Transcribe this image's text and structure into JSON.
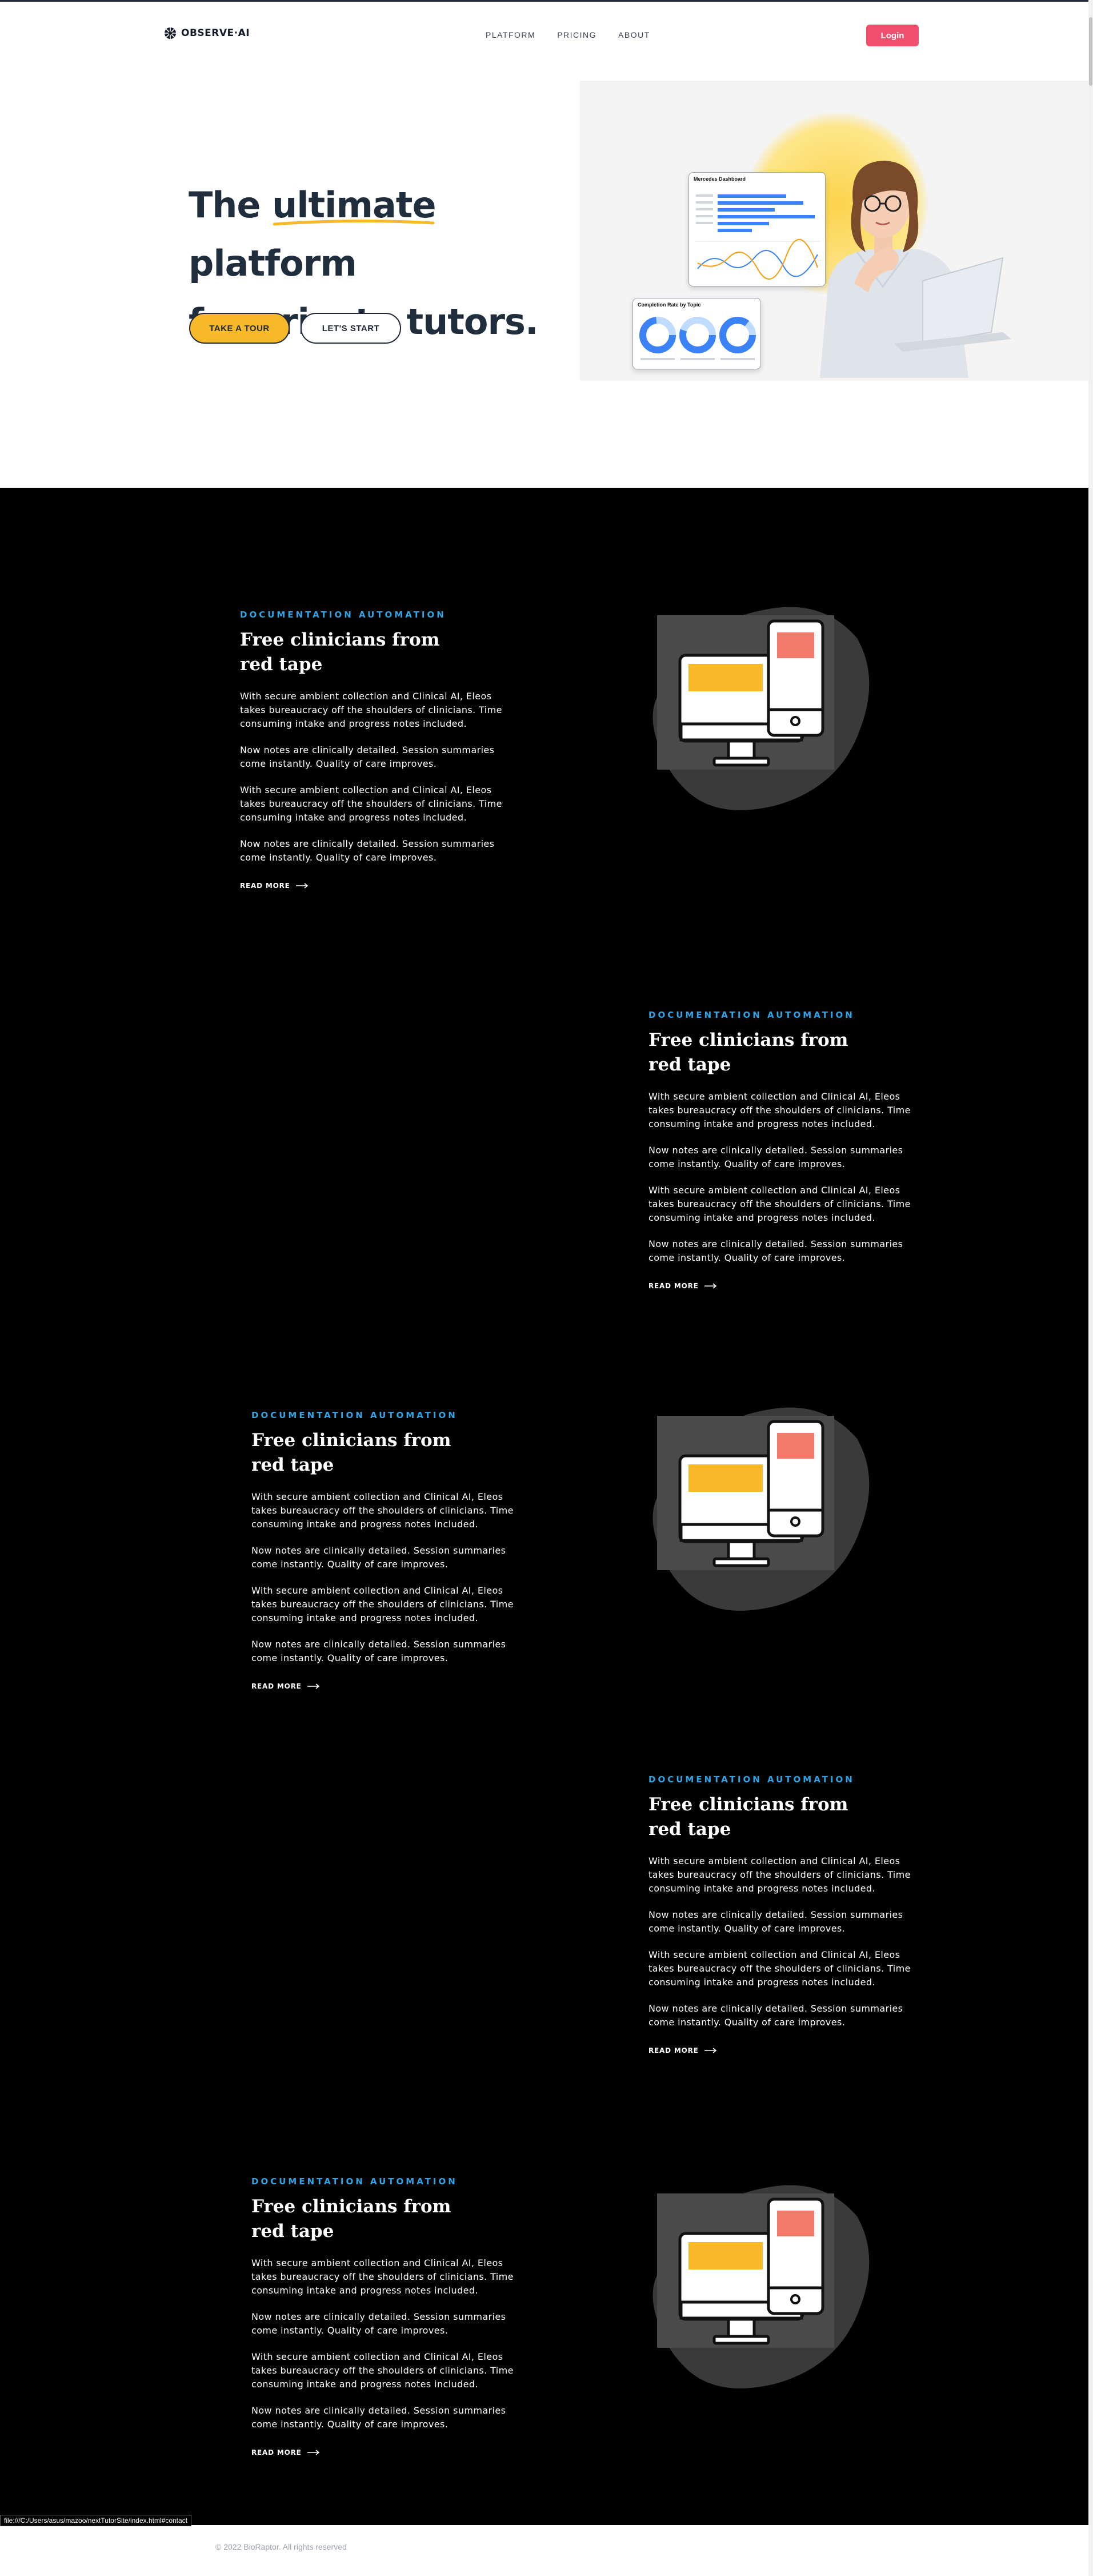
{
  "brand": {
    "name": "OBSERVE·AI"
  },
  "nav": {
    "items": [
      "PLATFORM",
      "PRICING",
      "ABOUT"
    ],
    "login": "Login"
  },
  "hero": {
    "title_before": "The ",
    "title_highlight": "ultimate",
    "title_after": " platform",
    "title_line2": "for private tutors.",
    "btn_primary": "TAKE A TOUR",
    "btn_secondary": "LET'S START",
    "dashboard_card_title": "Mercedes Dashboard",
    "donut_card_title": "Completion Rate by Topic"
  },
  "features": [
    {
      "eyebrow": "DOCUMENTATION AUTOMATION",
      "title": "Free clinicians from red tape",
      "paragraphs": [
        "With secure ambient collection and Clinical AI, Eleos takes bureaucracy off the shoulders of clinicians. Time consuming intake and progress notes included.",
        "Now notes are clinically detailed. Session summaries come instantly. Quality of care improves.",
        "With secure ambient collection and Clinical AI, Eleos takes bureaucracy off the shoulders of clinicians. Time consuming intake and progress notes included.",
        "Now notes are clinically detailed. Session summaries come instantly. Quality of care improves."
      ],
      "read_more": "READ MORE"
    },
    {
      "eyebrow": "DOCUMENTATION AUTOMATION",
      "title": "Free clinicians from red tape",
      "paragraphs": [
        "With secure ambient collection and Clinical AI, Eleos takes bureaucracy off the shoulders of clinicians. Time consuming intake and progress notes included.",
        "Now notes are clinically detailed. Session summaries come instantly. Quality of care improves.",
        "With secure ambient collection and Clinical AI, Eleos takes bureaucracy off the shoulders of clinicians. Time consuming intake and progress notes included.",
        "Now notes are clinically detailed. Session summaries come instantly. Quality of care improves."
      ],
      "read_more": "READ MORE"
    },
    {
      "eyebrow": "DOCUMENTATION AUTOMATION",
      "title": "Free clinicians from red tape",
      "paragraphs": [
        "With secure ambient collection and Clinical AI, Eleos takes bureaucracy off the shoulders of clinicians. Time consuming intake and progress notes included.",
        "Now notes are clinically detailed. Session summaries come instantly. Quality of care improves.",
        "With secure ambient collection and Clinical AI, Eleos takes bureaucracy off the shoulders of clinicians. Time consuming intake and progress notes included.",
        "Now notes are clinically detailed. Session summaries come instantly. Quality of care improves."
      ],
      "read_more": "READ MORE"
    },
    {
      "eyebrow": "DOCUMENTATION AUTOMATION",
      "title": "Free clinicians from red tape",
      "paragraphs": [
        "With secure ambient collection and Clinical AI, Eleos takes bureaucracy off the shoulders of clinicians. Time consuming intake and progress notes included.",
        "Now notes are clinically detailed. Session summaries come instantly. Quality of care improves.",
        "With secure ambient collection and Clinical AI, Eleos takes bureaucracy off the shoulders of clinicians. Time consuming intake and progress notes included.",
        "Now notes are clinically detailed. Session summaries come instantly. Quality of care improves."
      ],
      "read_more": "READ MORE"
    },
    {
      "eyebrow": "DOCUMENTATION AUTOMATION",
      "title": "Free clinicians from red tape",
      "paragraphs": [
        "With secure ambient collection and Clinical AI, Eleos takes bureaucracy off the shoulders of clinicians. Time consuming intake and progress notes included.",
        "Now notes are clinically detailed. Session summaries come instantly. Quality of care improves.",
        "With secure ambient collection and Clinical AI, Eleos takes bureaucracy off the shoulders of clinicians. Time consuming intake and progress notes included.",
        "Now notes are clinically detailed. Session summaries come instantly. Quality of care improves."
      ],
      "read_more": "READ MORE"
    }
  ],
  "footer": {
    "copyright": "© 2022 BioRaptor. All rights reserved"
  },
  "status_bar": {
    "url": "file:///C:/Users/asus/mazoo/nextTutorSite/index.html#contact"
  },
  "colors": {
    "accent_blue": "#2fa4e7",
    "login_pink": "#f0506e",
    "cta_yellow": "#f8b928",
    "dark_bg": "#000000"
  },
  "icons": [
    "logo-icon",
    "arrow-right-icon",
    "computer-phone-illustration"
  ]
}
